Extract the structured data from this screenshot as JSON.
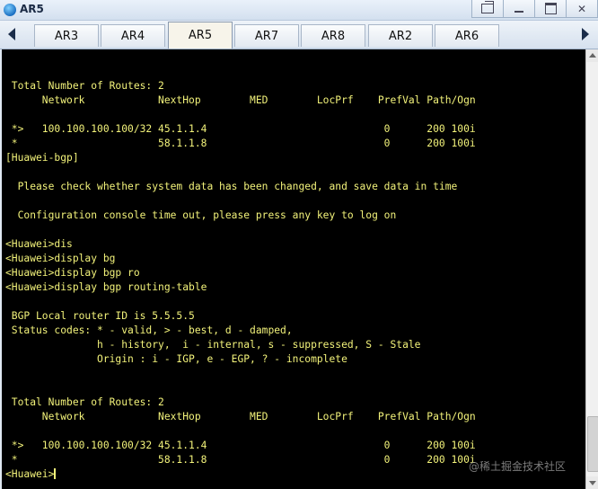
{
  "window": {
    "title": "AR5",
    "icon": "app-logo-icon"
  },
  "tabs": [
    {
      "label": "AR3",
      "active": false
    },
    {
      "label": "AR4",
      "active": false
    },
    {
      "label": "AR5",
      "active": true
    },
    {
      "label": "AR7",
      "active": false
    },
    {
      "label": "AR8",
      "active": false
    },
    {
      "label": "AR2",
      "active": false
    },
    {
      "label": "AR6",
      "active": false
    }
  ],
  "terminal": {
    "text_color": "#f2f27a",
    "background": "#000000",
    "lines": [
      "",
      "",
      " Total Number of Routes: 2",
      "      Network            NextHop        MED        LocPrf    PrefVal Path/Ogn",
      "",
      " *>   100.100.100.100/32 45.1.1.4                             0      200 100i",
      " *                       58.1.1.8                             0      200 100i",
      "[Huawei-bgp]",
      "",
      "  Please check whether system data has been changed, and save data in time",
      "",
      "  Configuration console time out, please press any key to log on",
      "",
      "<Huawei>dis",
      "<Huawei>display bg",
      "<Huawei>display bgp ro",
      "<Huawei>display bgp routing-table",
      "",
      " BGP Local router ID is 5.5.5.5",
      " Status codes: * - valid, > - best, d - damped,",
      "               h - history,  i - internal, s - suppressed, S - Stale",
      "               Origin : i - IGP, e - EGP, ? - incomplete",
      "",
      "",
      " Total Number of Routes: 2",
      "      Network            NextHop        MED        LocPrf    PrefVal Path/Ogn",
      "",
      " *>   100.100.100.100/32 45.1.1.4                             0      200 100i",
      " *                       58.1.1.8                             0      200 100i",
      "<Huawei>"
    ]
  },
  "watermark": "@稀土掘金技术社区"
}
